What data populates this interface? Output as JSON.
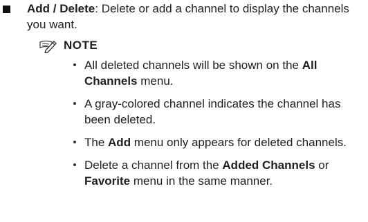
{
  "main_item": {
    "term": "Add / Delete",
    "description": ": Delete or add a channel to display the channels you want."
  },
  "note": {
    "title": "NOTE",
    "icon": "pencil-note-icon"
  },
  "note_items": [
    {
      "t1": "All deleted channels will be shown on the ",
      "b1": "All Channels",
      "t2": " menu."
    },
    {
      "t1": "A gray-colored channel indicates the channel has been deleted."
    },
    {
      "t1": "The ",
      "b1": "Add",
      "t2": " menu only appears for deleted channels."
    },
    {
      "t1": "Delete a channel from the ",
      "b1": "Added Channels",
      "t2": " or ",
      "b2": "Favorite",
      "t3": " menu in the same manner."
    }
  ]
}
